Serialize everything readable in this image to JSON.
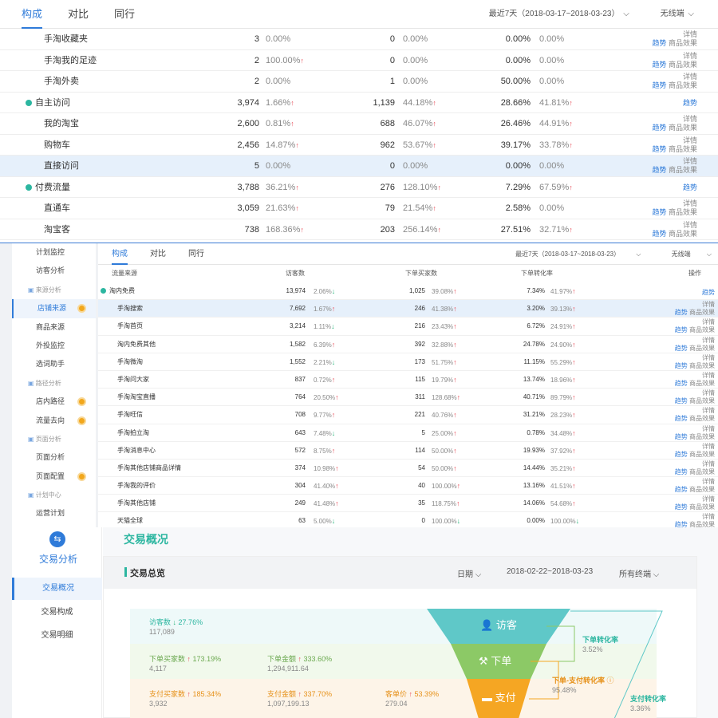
{
  "panel1": {
    "tabs": [
      "构成",
      "对比",
      "同行"
    ],
    "date_range": "最近7天（2018-03-17~2018-03-23）",
    "terminal": "无线端",
    "rows": [
      {
        "name": "手淘收藏夹",
        "v1": "3",
        "p1": "0.00%",
        "a1": "",
        "v2": "0",
        "p2": "0.00%",
        "a2": "",
        "v3": "0.00%",
        "p3": "0.00%",
        "a3": "",
        "level": 1,
        "hl": false,
        "actions": [
          "趋势",
          "详情",
          "商品效果"
        ]
      },
      {
        "name": "手淘我的足迹",
        "v1": "2",
        "p1": "100.00%",
        "a1": "up",
        "v2": "0",
        "p2": "0.00%",
        "a2": "",
        "v3": "0.00%",
        "p3": "0.00%",
        "a3": "",
        "level": 1,
        "hl": false,
        "actions": [
          "趋势",
          "详情",
          "商品效果"
        ]
      },
      {
        "name": "手淘外卖",
        "v1": "2",
        "p1": "0.00%",
        "a1": "",
        "v2": "1",
        "p2": "0.00%",
        "a2": "",
        "v3": "50.00%",
        "p3": "0.00%",
        "a3": "",
        "level": 1,
        "hl": false,
        "actions": [
          "趋势",
          "详情",
          "商品效果"
        ]
      },
      {
        "name": "自主访问",
        "v1": "3,974",
        "p1": "1.66%",
        "a1": "up",
        "v2": "1,139",
        "p2": "44.18%",
        "a2": "up",
        "v3": "28.66%",
        "p3": "41.81%",
        "a3": "up",
        "level": 0,
        "hl": false,
        "actions": [
          "趋势"
        ]
      },
      {
        "name": "我的淘宝",
        "v1": "2,600",
        "p1": "0.81%",
        "a1": "up",
        "v2": "688",
        "p2": "46.07%",
        "a2": "up",
        "v3": "26.46%",
        "p3": "44.91%",
        "a3": "up",
        "level": 1,
        "hl": false,
        "actions": [
          "趋势",
          "详情",
          "商品效果"
        ]
      },
      {
        "name": "购物车",
        "v1": "2,456",
        "p1": "14.87%",
        "a1": "up",
        "v2": "962",
        "p2": "53.67%",
        "a2": "up",
        "v3": "39.17%",
        "p3": "33.78%",
        "a3": "up",
        "level": 1,
        "hl": false,
        "actions": [
          "趋势",
          "详情",
          "商品效果"
        ]
      },
      {
        "name": "直接访问",
        "v1": "5",
        "p1": "0.00%",
        "a1": "",
        "v2": "0",
        "p2": "0.00%",
        "a2": "",
        "v3": "0.00%",
        "p3": "0.00%",
        "a3": "",
        "level": 1,
        "hl": true,
        "actions": [
          "趋势",
          "详情",
          "商品效果"
        ]
      },
      {
        "name": "付费流量",
        "v1": "3,788",
        "p1": "36.21%",
        "a1": "up",
        "v2": "276",
        "p2": "128.10%",
        "a2": "up",
        "v3": "7.29%",
        "p3": "67.59%",
        "a3": "up",
        "level": 0,
        "hl": false,
        "actions": [
          "趋势"
        ]
      },
      {
        "name": "直通车",
        "v1": "3,059",
        "p1": "21.63%",
        "a1": "up",
        "v2": "79",
        "p2": "21.54%",
        "a2": "up",
        "v3": "2.58%",
        "p3": "0.00%",
        "a3": "",
        "level": 1,
        "hl": false,
        "actions": [
          "趋势",
          "详情",
          "商品效果"
        ]
      },
      {
        "name": "淘宝客",
        "v1": "738",
        "p1": "168.36%",
        "a1": "up",
        "v2": "203",
        "p2": "256.14%",
        "a2": "up",
        "v3": "27.51%",
        "p3": "32.71%",
        "a3": "up",
        "level": 1,
        "hl": false,
        "actions": [
          "趋势",
          "详情",
          "商品效果"
        ]
      }
    ]
  },
  "panel2": {
    "sidebar": [
      {
        "label": "计划监控",
        "type": "item",
        "badge": false
      },
      {
        "label": "访客分析",
        "type": "item",
        "badge": false
      },
      {
        "label": "来源分析",
        "type": "group",
        "badge": false
      },
      {
        "label": "店铺来源",
        "type": "active",
        "badge": true
      },
      {
        "label": "商品来源",
        "type": "item",
        "badge": false
      },
      {
        "label": "外投监控",
        "type": "item",
        "badge": false
      },
      {
        "label": "选词助手",
        "type": "item",
        "badge": false
      },
      {
        "label": "路径分析",
        "type": "group",
        "badge": false
      },
      {
        "label": "店内路径",
        "type": "item",
        "badge": true
      },
      {
        "label": "流量去向",
        "type": "item",
        "badge": true
      },
      {
        "label": "页面分析",
        "type": "group",
        "badge": false
      },
      {
        "label": "页面分析",
        "type": "item",
        "badge": false
      },
      {
        "label": "页面配置",
        "type": "item",
        "badge": true
      },
      {
        "label": "计划中心",
        "type": "group",
        "badge": false
      },
      {
        "label": "运营计划",
        "type": "item",
        "badge": false
      }
    ],
    "tabs": [
      "构成",
      "对比",
      "同行"
    ],
    "date_range": "最近7天（2018-03-17~2018-03-23）",
    "terminal": "无线端",
    "headers": [
      "流量来源",
      "访客数",
      "下单买家数",
      "下单转化率",
      "操作"
    ],
    "rows": [
      {
        "name": "淘内免费",
        "v1": "13,974",
        "p1": "2.06%",
        "a1": "down",
        "v2": "1,025",
        "p2": "39.08%",
        "a2": "up",
        "v3": "7.34%",
        "p3": "41.97%",
        "a3": "up",
        "level": 0,
        "hl": false,
        "actions": [
          "趋势"
        ]
      },
      {
        "name": "手淘搜索",
        "v1": "7,692",
        "p1": "1.67%",
        "a1": "up",
        "v2": "246",
        "p2": "41.38%",
        "a2": "up",
        "v3": "3.20%",
        "p3": "39.13%",
        "a3": "up",
        "level": 1,
        "hl": true,
        "actions": [
          "趋势",
          "详情",
          "商品效果"
        ]
      },
      {
        "name": "手淘首页",
        "v1": "3,214",
        "p1": "1.11%",
        "a1": "down",
        "v2": "216",
        "p2": "23.43%",
        "a2": "up",
        "v3": "6.72%",
        "p3": "24.91%",
        "a3": "up",
        "level": 1,
        "hl": false,
        "actions": [
          "趋势",
          "详情",
          "商品效果"
        ]
      },
      {
        "name": "淘内免费其他",
        "v1": "1,582",
        "p1": "6.39%",
        "a1": "up",
        "v2": "392",
        "p2": "32.88%",
        "a2": "up",
        "v3": "24.78%",
        "p3": "24.90%",
        "a3": "up",
        "level": 1,
        "hl": false,
        "actions": [
          "趋势",
          "详情",
          "商品效果"
        ]
      },
      {
        "name": "手淘微淘",
        "v1": "1,552",
        "p1": "2.21%",
        "a1": "down",
        "v2": "173",
        "p2": "51.75%",
        "a2": "up",
        "v3": "11.15%",
        "p3": "55.29%",
        "a3": "up",
        "level": 1,
        "hl": false,
        "actions": [
          "趋势",
          "详情",
          "商品效果"
        ]
      },
      {
        "name": "手淘问大家",
        "v1": "837",
        "p1": "0.72%",
        "a1": "up",
        "v2": "115",
        "p2": "19.79%",
        "a2": "up",
        "v3": "13.74%",
        "p3": "18.96%",
        "a3": "up",
        "level": 1,
        "hl": false,
        "actions": [
          "趋势",
          "详情",
          "商品效果"
        ]
      },
      {
        "name": "手淘淘宝直播",
        "v1": "764",
        "p1": "20.50%",
        "a1": "up",
        "v2": "311",
        "p2": "128.68%",
        "a2": "up",
        "v3": "40.71%",
        "p3": "89.79%",
        "a3": "up",
        "level": 1,
        "hl": false,
        "actions": [
          "趋势",
          "详情",
          "商品效果"
        ]
      },
      {
        "name": "手淘旺信",
        "v1": "708",
        "p1": "9.77%",
        "a1": "up",
        "v2": "221",
        "p2": "40.76%",
        "a2": "up",
        "v3": "31.21%",
        "p3": "28.23%",
        "a3": "up",
        "level": 1,
        "hl": false,
        "actions": [
          "趋势",
          "详情",
          "商品效果"
        ]
      },
      {
        "name": "手淘拍立淘",
        "v1": "643",
        "p1": "7.48%",
        "a1": "down",
        "v2": "5",
        "p2": "25.00%",
        "a2": "up",
        "v3": "0.78%",
        "p3": "34.48%",
        "a3": "up",
        "level": 1,
        "hl": false,
        "actions": [
          "趋势",
          "详情",
          "商品效果"
        ]
      },
      {
        "name": "手淘消息中心",
        "v1": "572",
        "p1": "8.75%",
        "a1": "up",
        "v2": "114",
        "p2": "50.00%",
        "a2": "up",
        "v3": "19.93%",
        "p3": "37.92%",
        "a3": "up",
        "level": 1,
        "hl": false,
        "actions": [
          "趋势",
          "详情",
          "商品效果"
        ]
      },
      {
        "name": "手淘其他店铺商品详情",
        "v1": "374",
        "p1": "10.98%",
        "a1": "up",
        "v2": "54",
        "p2": "50.00%",
        "a2": "up",
        "v3": "14.44%",
        "p3": "35.21%",
        "a3": "up",
        "level": 1,
        "hl": false,
        "actions": [
          "趋势",
          "详情",
          "商品效果"
        ]
      },
      {
        "name": "手淘我的评价",
        "v1": "304",
        "p1": "41.40%",
        "a1": "up",
        "v2": "40",
        "p2": "100.00%",
        "a2": "up",
        "v3": "13.16%",
        "p3": "41.51%",
        "a3": "up",
        "level": 1,
        "hl": false,
        "actions": [
          "趋势",
          "详情",
          "商品效果"
        ]
      },
      {
        "name": "手淘其他店铺",
        "v1": "249",
        "p1": "41.48%",
        "a1": "up",
        "v2": "35",
        "p2": "118.75%",
        "a2": "up",
        "v3": "14.06%",
        "p3": "54.68%",
        "a3": "up",
        "level": 1,
        "hl": false,
        "actions": [
          "趋势",
          "详情",
          "商品效果"
        ]
      },
      {
        "name": "天猫全球",
        "v1": "63",
        "p1": "5.00%",
        "a1": "down",
        "v2": "0",
        "p2": "100.00%",
        "a2": "down",
        "v3": "0.00%",
        "p3": "100.00%",
        "a3": "down",
        "level": 1,
        "hl": false,
        "actions": [
          "趋势",
          "详情",
          "商品效果"
        ]
      }
    ]
  },
  "panel3": {
    "sidebar_title": "交易分析",
    "sidebar_items": [
      "交易概况",
      "交易构成",
      "交易明细"
    ],
    "title": "交易概况",
    "section": "交易总览",
    "period_label": "日期",
    "date_range": "2018-02-22~2018-03-23",
    "terminal": "所有终端",
    "visitors": {
      "label": "访客数",
      "change": "27.76%",
      "dir": "down",
      "value": "117,089"
    },
    "order_buyers": {
      "label": "下单买家数",
      "change": "173.19%",
      "dir": "up",
      "value": "4,117"
    },
    "order_amount": {
      "label": "下单金额",
      "change": "333.60%",
      "dir": "up",
      "value": "1,294,911.64"
    },
    "pay_buyers": {
      "label": "支付买家数",
      "change": "185.34%",
      "dir": "up",
      "value": "3,932"
    },
    "pay_amount": {
      "label": "支付金额",
      "change": "337.70%",
      "dir": "up",
      "value": "1,097,199.13"
    },
    "unit_price": {
      "label": "客单价",
      "change": "53.39%",
      "dir": "up",
      "value": "279.04"
    },
    "funnel": [
      "访客",
      "下单",
      "支付"
    ],
    "order_rate": {
      "label": "下单转化率",
      "value": "3.52%"
    },
    "order_pay_rate": {
      "label": "下单-支付转化率",
      "value": "95.48%"
    },
    "pay_rate": {
      "label": "支付转化率",
      "value": "3.36%"
    },
    "colors": {
      "teal": "#5fc8c8",
      "green": "#8cc966",
      "orange": "#f5a623"
    }
  }
}
